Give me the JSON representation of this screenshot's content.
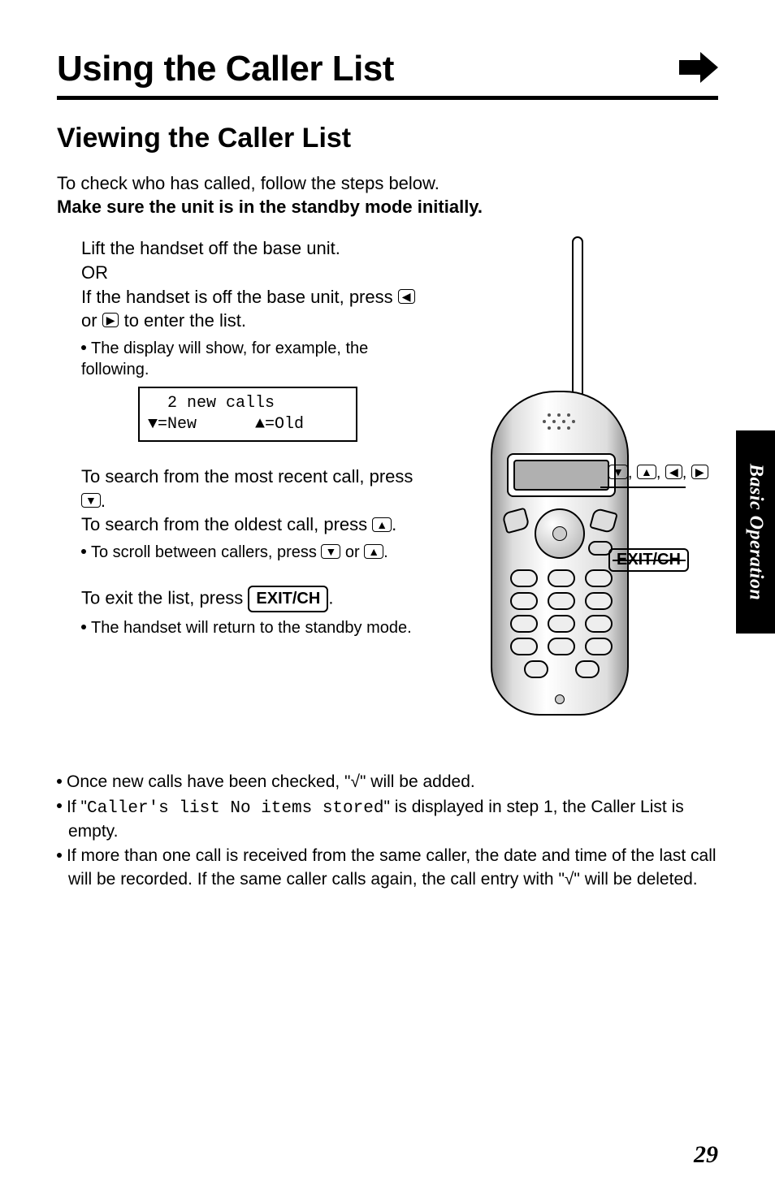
{
  "header": {
    "chapter_title": "Using the Caller List"
  },
  "section": {
    "title": "Viewing the Caller List",
    "intro_line1": "To check who has called, follow the steps below.",
    "intro_line2_bold": "Make sure the unit is in the standby mode initially."
  },
  "steps": {
    "s1_line1": "Lift the handset off the base unit.",
    "s1_line2": "OR",
    "s1_line3_a": "If the handset is off the base unit, press ",
    "s1_line3_b": " or ",
    "s1_line3_c": " to enter the list.",
    "s1_sub": "The display will show, for example, the following.",
    "lcd_line1": "  2 new calls",
    "lcd_line2": "▼=New      ▲=Old",
    "s2_line1_a": "To search from the most recent call, press ",
    "s2_line1_b": ".",
    "s2_line2_a": "To search from the oldest call, press ",
    "s2_line2_b": ".",
    "s2_sub_a": "To scroll between callers, press ",
    "s2_sub_b": " or ",
    "s2_sub_c": ".",
    "s3_line_a": "To exit the list, press ",
    "s3_line_b": ".",
    "s3_sub": "The handset will return to the standby mode."
  },
  "keys": {
    "left": "◀",
    "right": "▶",
    "down": "▼",
    "up": "▲",
    "exit_ch": "EXIT/CH"
  },
  "callouts": {
    "dpad": "▼, ▲, ◀, ▶",
    "exit_ch": "EXIT/CH"
  },
  "notes": {
    "n1": "Once new calls have been checked, \"√\" will be added.",
    "n2_a": "If \"",
    "n2_mono": "Caller's list No items stored",
    "n2_b": "\" is displayed in step 1, the Caller List is empty.",
    "n3": "If more than one call is received from the same caller, the date and time of the last call will be recorded. If the same caller calls again, the call entry with \"√\" will be deleted."
  },
  "side_tab": "Basic Operation",
  "page_number": "29"
}
